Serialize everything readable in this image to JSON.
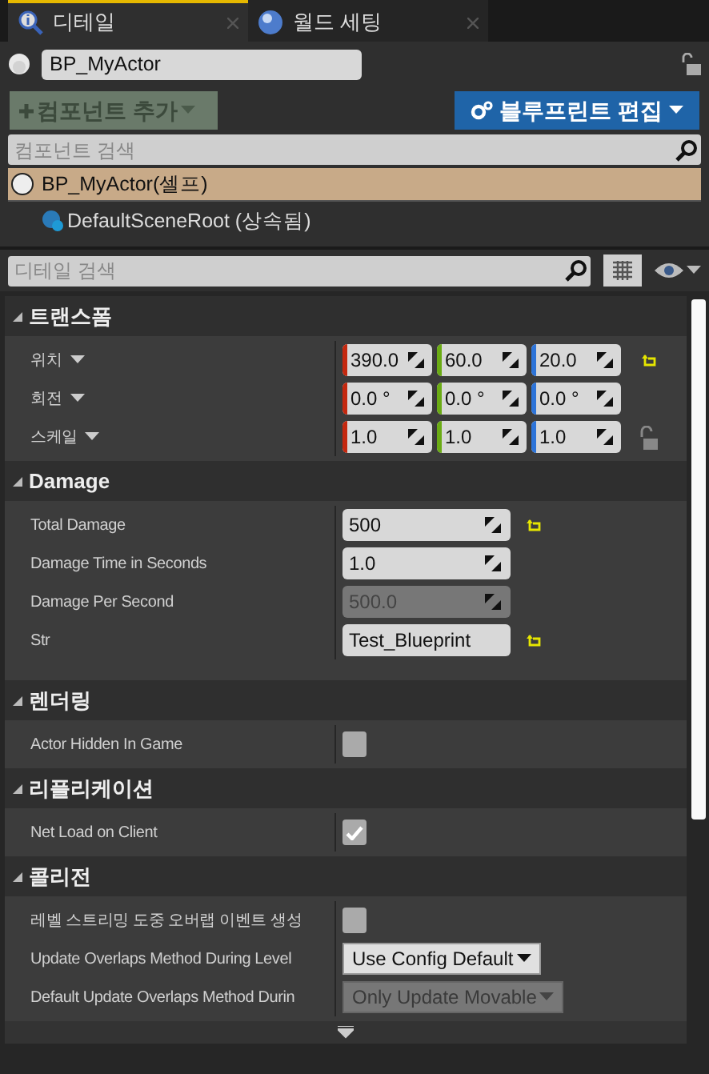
{
  "tabs": [
    {
      "kind": "details",
      "label": "디테일",
      "selected": true
    },
    {
      "kind": "world",
      "label": "월드 세팅",
      "selected": false
    }
  ],
  "actor_name": "BP_MyActor",
  "add_component_button": {
    "label": "컴포넌트 추가",
    "disabled": true
  },
  "edit_blueprint_button": {
    "label": "블루프린트 편집"
  },
  "component_search": {
    "placeholder": "컴포넌트 검색"
  },
  "components": [
    {
      "label": "BP_MyActor(셀프)",
      "selected": true,
      "children": [
        {
          "label": "DefaultSceneRoot (상속됨)",
          "selected": false
        }
      ]
    }
  ],
  "details_search": {
    "placeholder": "디테일 검색"
  },
  "categories": [
    {
      "title": "트랜스폼",
      "expanded": true,
      "properties": [
        {
          "kind": "vector",
          "label": "위치",
          "values": [
            "390.0",
            "60.0",
            "20.0"
          ],
          "modified": true
        },
        {
          "kind": "vector",
          "label": "회전",
          "values": [
            "0.0 °",
            "0.0 °",
            "0.0 °"
          ],
          "modified": false
        },
        {
          "kind": "vector",
          "label": "스케일",
          "values": [
            "1.0",
            "1.0",
            "1.0"
          ],
          "modified": false,
          "locked": false
        }
      ]
    },
    {
      "title": "Damage",
      "expanded": true,
      "properties": [
        {
          "kind": "number",
          "label": "Total Damage",
          "value": "500",
          "modified": true,
          "disabled": false
        },
        {
          "kind": "number",
          "label": "Damage Time in Seconds",
          "value": "1.0",
          "modified": false,
          "disabled": false
        },
        {
          "kind": "number",
          "label": "Damage Per Second",
          "value": "500.0",
          "modified": false,
          "disabled": true
        },
        {
          "kind": "text",
          "label": "Str",
          "value": "Test_Blueprint",
          "modified": true,
          "disabled": false
        }
      ]
    },
    {
      "title": "렌더링",
      "expanded": true,
      "properties": [
        {
          "kind": "checkbox",
          "label": "Actor Hidden In Game",
          "checked": false
        }
      ]
    },
    {
      "title": "리플리케이션",
      "expanded": true,
      "properties": [
        {
          "kind": "checkbox",
          "label": "Net Load on Client",
          "checked": true
        }
      ]
    },
    {
      "title": "콜리전",
      "expanded": true,
      "properties": [
        {
          "kind": "checkbox",
          "label": "레벨 스트리밍 도중 오버랩 이벤트 생성",
          "checked": false
        },
        {
          "kind": "dropdown",
          "label": "Update Overlaps Method During Level",
          "value": "Use Config Default",
          "disabled": false
        },
        {
          "kind": "dropdown",
          "label": "Default Update Overlaps Method Durin",
          "value": "Only Update Movable",
          "disabled": true
        }
      ]
    }
  ]
}
